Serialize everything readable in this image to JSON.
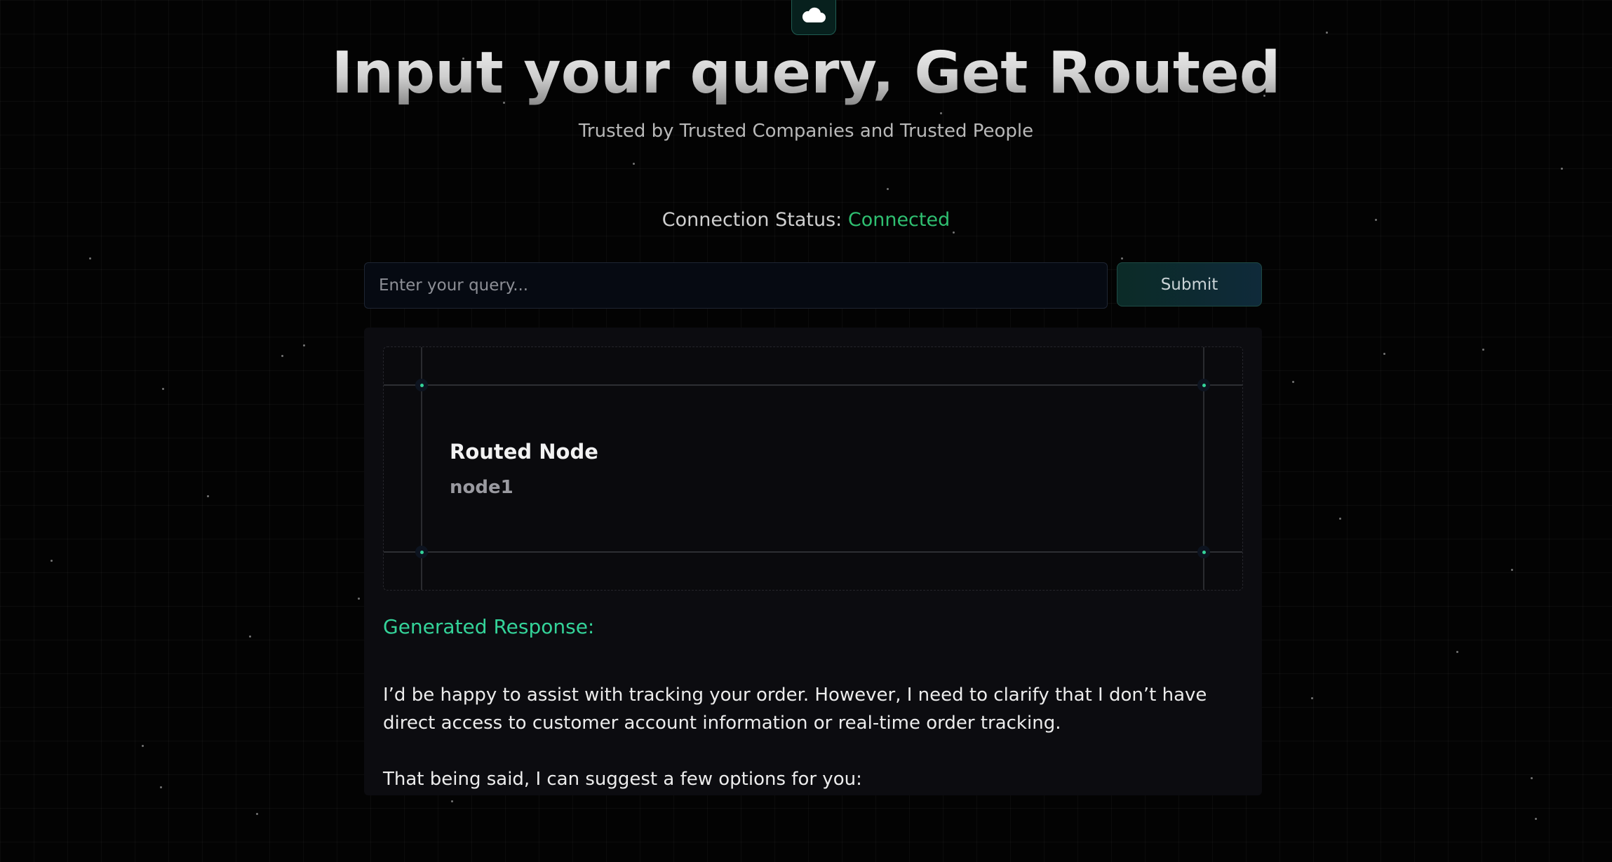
{
  "header": {
    "logo_icon": "cloud-icon",
    "title": "Input your query, Get Routed",
    "subtitle": "Trusted by Trusted Companies and Trusted People"
  },
  "connection": {
    "label": "Connection Status:",
    "value": "Connected",
    "value_color": "#2fbf71"
  },
  "query": {
    "placeholder": "Enter your query...",
    "value": "",
    "submit_label": "Submit"
  },
  "routing": {
    "title": "Routed Node",
    "node": "node1"
  },
  "response": {
    "heading": "Generated Response:",
    "paragraphs": [
      "I’d be happy to assist with tracking your order. However, I need to clarify that I don’t have direct access to customer account information or real-time order tracking.",
      "That being said, I can suggest a few options for you:"
    ]
  },
  "colors": {
    "accent": "#34d399",
    "background": "#030303",
    "panel": "#0c0c10"
  }
}
